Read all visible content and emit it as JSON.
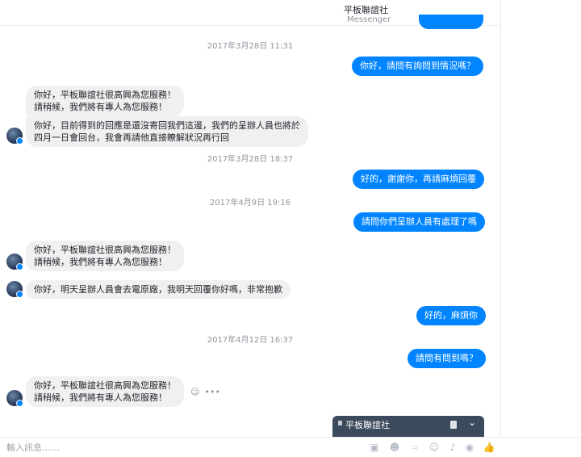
{
  "header": {
    "title": "平板聯誼社",
    "subtitle": "Messenger"
  },
  "timestamps": [
    "2017年3月28日 11:31",
    "2017年3月28日 18:37",
    "2017年4月9日 19:16",
    "2017年4月12日 16:37"
  ],
  "outgoing": [
    "你好，請問有詢問到情況嗎？",
    "好的，謝謝你，再請麻煩回覆",
    "請問你們呈辦人員有處理了嗎",
    "好的，麻煩你",
    "請問有問到嗎？"
  ],
  "incoming": [
    [
      "你好，平板聯誼社很高興為您服務！",
      "請稍候，我們將有專人為您服務！"
    ],
    [
      "你好，目前得到的回應是還沒寄回我們這邊，我們的呈辦人員也將於",
      "四月一日會回台，我會再請他直接瞭解狀況再行回"
    ],
    [
      "你好，平板聯誼社很高興為您服務！",
      "請稍候，我們將有專人為您服務！"
    ],
    [
      "你好，明天呈辦人員會去電原廠，我明天回覆你好嗎，非常抱歉"
    ],
    [
      "你好，平板聯誼社很高興為您服務！",
      "請稍候，我們將有專人為您服務！"
    ]
  ],
  "chat_popup": {
    "title": "平板聯誼社"
  },
  "composer": {
    "placeholder": "輸入訊息……"
  },
  "colors": {
    "accent": "#0084ff",
    "incoming_bubble": "#f1f0f0",
    "timestamp": "#90949c"
  },
  "icons": [
    "smile-icon",
    "more-icon",
    "lock-icon",
    "document-icon",
    "chevron-down-icon",
    "photo-icon",
    "sticker-icon",
    "gif-icon",
    "emoji-icon",
    "mic-icon",
    "camera-icon",
    "like-icon"
  ]
}
